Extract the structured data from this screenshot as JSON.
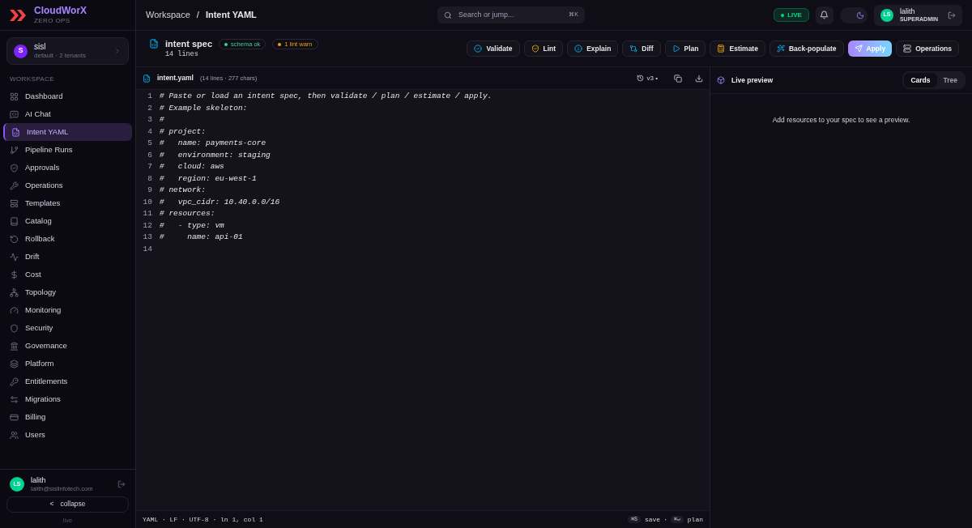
{
  "brand": {
    "name": "CloudWorX",
    "tagline": "ZERO OPS"
  },
  "tenant": {
    "initial": "S",
    "name": "sisl",
    "detail": "default · 2 tenants"
  },
  "sidebar": {
    "section": "WORKSPACE",
    "items": [
      {
        "label": "Dashboard",
        "selected": false
      },
      {
        "label": "AI Chat",
        "selected": false
      },
      {
        "label": "Intent YAML",
        "selected": true
      },
      {
        "label": "Pipeline Runs",
        "selected": false
      },
      {
        "label": "Approvals",
        "selected": false
      },
      {
        "label": "Operations",
        "selected": false
      },
      {
        "label": "Templates",
        "selected": false
      },
      {
        "label": "Catalog",
        "selected": false
      },
      {
        "label": "Rollback",
        "selected": false
      },
      {
        "label": "Drift",
        "selected": false
      },
      {
        "label": "Cost",
        "selected": false
      },
      {
        "label": "Topology",
        "selected": false
      },
      {
        "label": "Monitoring",
        "selected": false
      },
      {
        "label": "Security",
        "selected": false
      },
      {
        "label": "Governance",
        "selected": false
      },
      {
        "label": "Platform",
        "selected": false
      },
      {
        "label": "Entitlements",
        "selected": false
      },
      {
        "label": "Migrations",
        "selected": false
      },
      {
        "label": "Billing",
        "selected": false
      },
      {
        "label": "Users",
        "selected": false
      }
    ]
  },
  "sidebar_user": {
    "initials": "LS",
    "name": "lalith",
    "email": "lalith@sislinfotech.com"
  },
  "collapse": {
    "label": "collapse",
    "arrow": "<"
  },
  "sidebar_footer": "live",
  "breadcrumb": {
    "parent": "Workspace",
    "separator": "/",
    "current": "Intent YAML"
  },
  "search": {
    "placeholder": "Search or jump...",
    "shortcut": "⌘K"
  },
  "live_badge": "LIVE",
  "theme": {
    "dark": true
  },
  "user": {
    "initials": "LS",
    "name": "lalith",
    "role": "SUPERADMIN"
  },
  "spec": {
    "title": "intent spec",
    "subtitle": "14 lines",
    "badges": [
      {
        "label": "schema ok",
        "color": "#34d399"
      },
      {
        "label": "1 lint warn",
        "color": "#f59e0b"
      }
    ]
  },
  "actions": [
    {
      "label": "Validate",
      "kind": "default"
    },
    {
      "label": "Lint",
      "kind": "default"
    },
    {
      "label": "Explain",
      "kind": "default"
    },
    {
      "label": "Diff",
      "kind": "default"
    },
    {
      "label": "Plan",
      "kind": "default"
    },
    {
      "label": "Estimate",
      "kind": "default"
    },
    {
      "label": "Back-populate",
      "kind": "default"
    },
    {
      "label": "Apply",
      "kind": "primary"
    },
    {
      "label": "Operations",
      "kind": "default"
    }
  ],
  "editor": {
    "filename": "intent.yaml",
    "meta": "(14 lines · 277 chars)",
    "version": "v3 •",
    "lines": [
      "# Paste or load an intent spec, then validate / plan / estimate / apply.",
      "# Example skeleton:",
      "#",
      "# project:",
      "#   name: payments-core",
      "#   environment: staging",
      "#   cloud: aws",
      "#   region: eu-west-1",
      "# network:",
      "#   vpc_cidr: 10.40.0.0/16",
      "# resources:",
      "#   - type: vm",
      "#     name: api-01"
    ],
    "line_numbers": [
      "1",
      "2",
      "3",
      "4",
      "5",
      "6",
      "7",
      "8",
      "9",
      "10",
      "11",
      "12",
      "13",
      "14"
    ],
    "status": "YAML · LF · UTF-8 · ln 1, col 1",
    "hints": [
      {
        "key": "⌘S",
        "label": "save"
      },
      {
        "key": "⌘↵",
        "label": "plan"
      }
    ],
    "hint_separator": "·"
  },
  "preview": {
    "title": "Live preview",
    "tabs": [
      {
        "label": "Cards",
        "selected": true
      },
      {
        "label": "Tree",
        "selected": false
      }
    ],
    "empty": "Add resources to your spec to see a preview."
  }
}
